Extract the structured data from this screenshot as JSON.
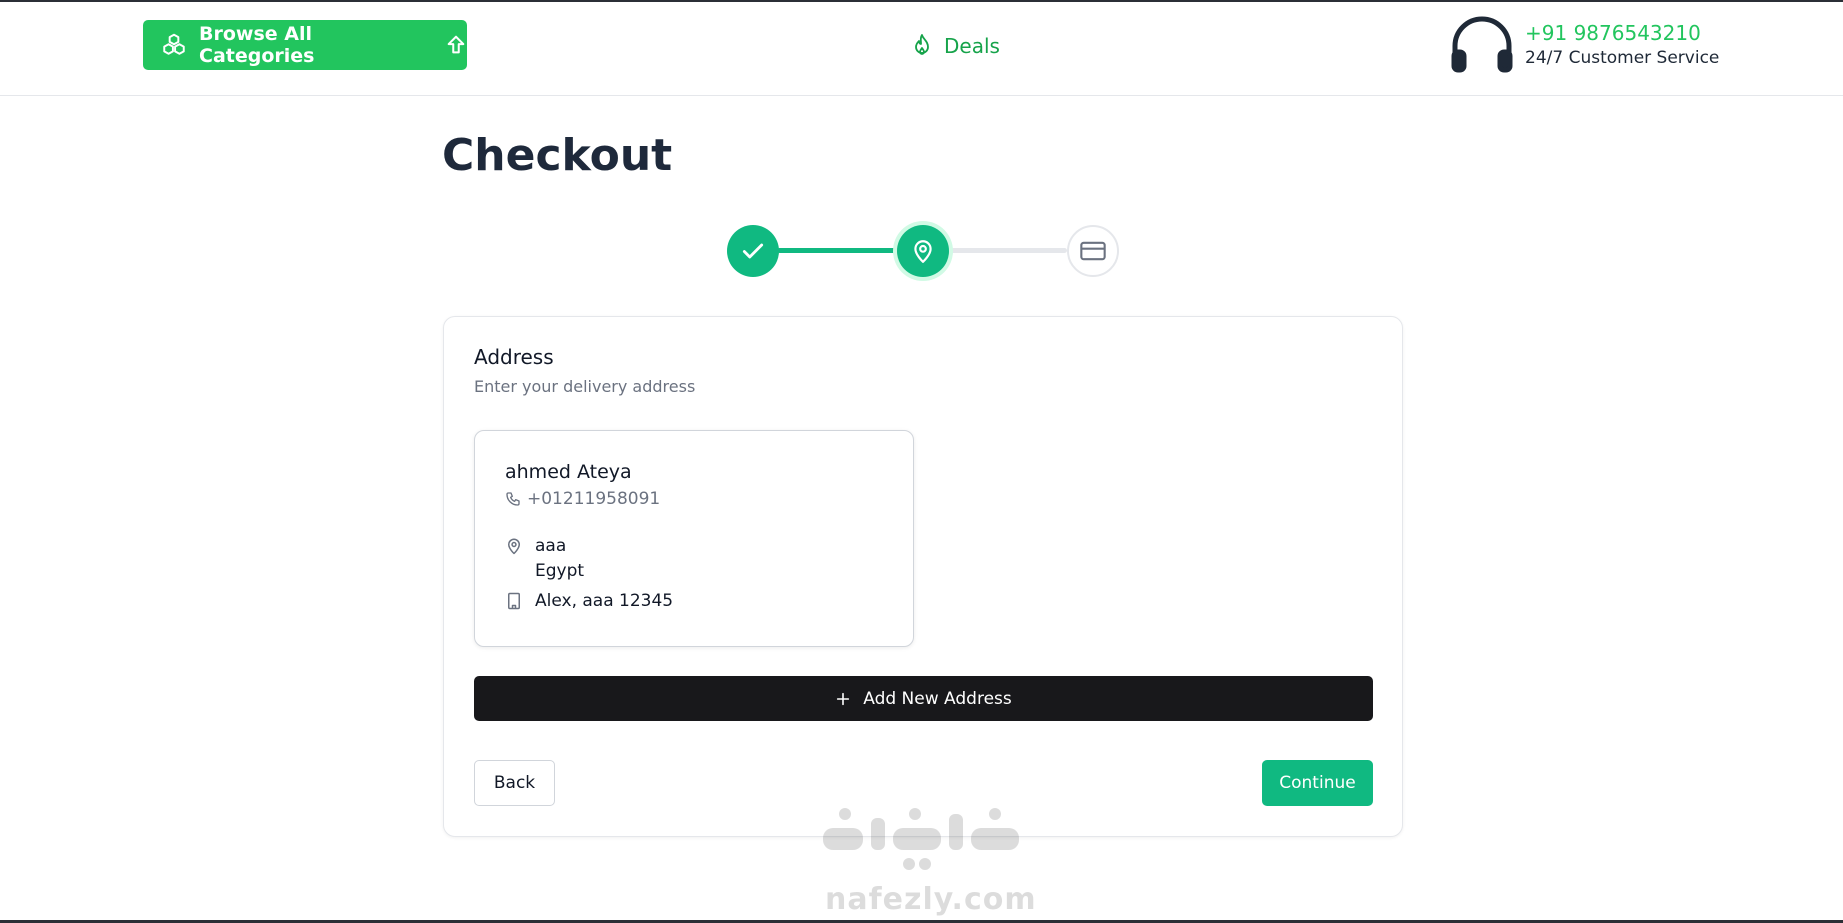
{
  "header": {
    "browse_label": "Browse All Categories",
    "deals_label": "Deals",
    "support_phone": "+91 9876543210",
    "support_label": "24/7 Customer Service"
  },
  "page": {
    "title": "Checkout"
  },
  "stepper": {
    "steps": [
      {
        "icon": "check-icon",
        "status": "completed"
      },
      {
        "icon": "map-pin-icon",
        "status": "active"
      },
      {
        "icon": "credit-card-icon",
        "status": "pending"
      }
    ]
  },
  "address_section": {
    "title": "Address",
    "subtitle": "Enter your delivery address",
    "selected_address": {
      "name": "ahmed Ateya",
      "phone": "+01211958091",
      "street": "aaa",
      "country": "Egypt",
      "city_line": "Alex, aaa 12345"
    },
    "add_new_label": "Add New Address"
  },
  "actions": {
    "back_label": "Back",
    "continue_label": "Continue"
  },
  "watermark": {
    "url": "nafezly.com"
  },
  "colors": {
    "brand_green": "#22c55e",
    "accent_teal": "#10b981",
    "dark_button": "#18181b",
    "heading": "#1e293b"
  }
}
